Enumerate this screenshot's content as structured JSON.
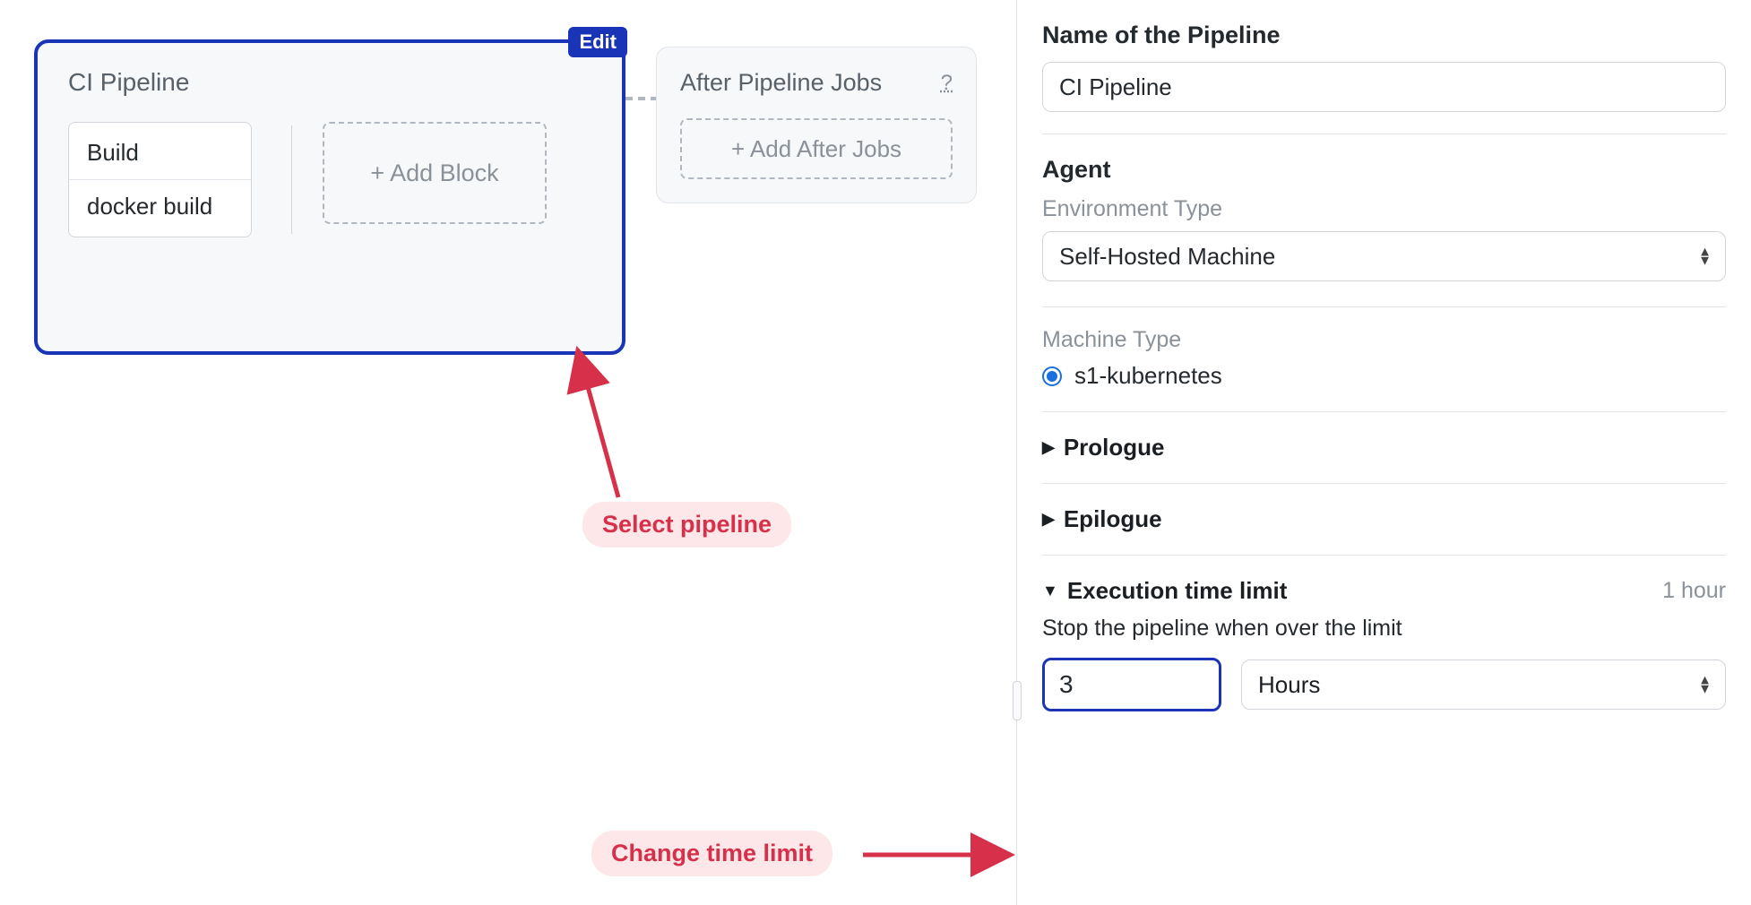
{
  "canvas": {
    "pipeline": {
      "title": "CI Pipeline",
      "edit_badge": "Edit",
      "block": {
        "name": "Build",
        "job": "docker build"
      },
      "add_block_label": "+ Add Block"
    },
    "after": {
      "title": "After Pipeline Jobs",
      "help": "?",
      "add_label": "+ Add After Jobs"
    }
  },
  "annotations": {
    "select_pipeline": "Select pipeline",
    "change_time_limit": "Change time limit"
  },
  "sidebar": {
    "name_label": "Name of the Pipeline",
    "name_value": "CI Pipeline",
    "agent": {
      "heading": "Agent",
      "env_type_label": "Environment Type",
      "env_type_value": "Self-Hosted Machine",
      "machine_type_label": "Machine Type",
      "machine_type_value": "s1-kubernetes"
    },
    "prologue_label": "Prologue",
    "epilogue_label": "Epilogue",
    "exec": {
      "heading": "Execution time limit",
      "hint": "1 hour",
      "desc": "Stop the pipeline when over the limit",
      "value": "3",
      "unit": "Hours"
    }
  }
}
